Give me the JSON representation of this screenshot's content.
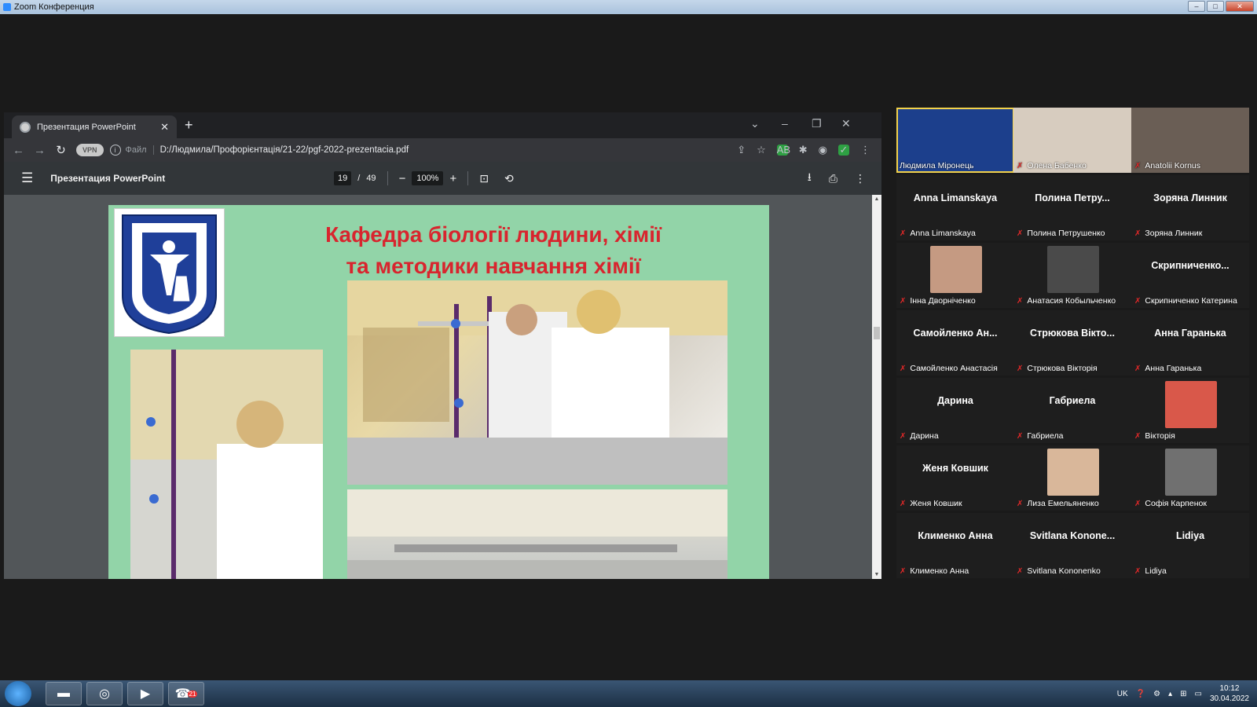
{
  "zoom_window": {
    "title": "Zoom Конференция"
  },
  "browser": {
    "tab_title": "Презентация PowerPoint",
    "vpn_label": "VPN",
    "file_label": "Файл",
    "url": "D:/Людмила/Профорієнтація/21-22/pgf-2022-prezentacia.pdf"
  },
  "pdf_viewer": {
    "title": "Презентация PowerPoint",
    "current_page": "19",
    "page_separator": "/",
    "total_pages": "49",
    "zoom": "100%"
  },
  "slide": {
    "title_line1": "Кафедра біології людини, хімії",
    "title_line2": "та методики навчання хімії"
  },
  "gallery": {
    "participants": [
      {
        "name": "Людмила Міронець",
        "display": "",
        "type": "video",
        "active": true,
        "bg": "#1c3f8c"
      },
      {
        "name": "Олена Бабенко",
        "display": "",
        "type": "video",
        "active": false,
        "bg": "#d7ccbf"
      },
      {
        "name": "Anatolii Kornus",
        "display": "",
        "type": "video",
        "active": false,
        "bg": "#6a5e55"
      },
      {
        "name": "Anna Limanskaya",
        "display": "Anna Limanskaya",
        "type": "name"
      },
      {
        "name": "Полина Петрушенко",
        "display": "Полина Петру...",
        "type": "name"
      },
      {
        "name": "Зоряна Линник",
        "display": "Зоряна Линник",
        "type": "name"
      },
      {
        "name": "Інна Дворніченко",
        "display": "",
        "type": "photo",
        "bg": "#c59a82"
      },
      {
        "name": "Анатасия Кобыльченко",
        "display": "",
        "type": "photo",
        "bg": "#4a4a4a"
      },
      {
        "name": "Скрипниченко Катерина",
        "display": "Скрипниченко...",
        "type": "name"
      },
      {
        "name": "Самойленко Анастасія",
        "display": "Самойленко Ан...",
        "type": "name"
      },
      {
        "name": "Стрюкова Вікторія",
        "display": "Стрюкова Вікто...",
        "type": "name"
      },
      {
        "name": "Анна Гаранька",
        "display": "Анна Гаранька",
        "type": "name"
      },
      {
        "name": "Дарина",
        "display": "Дарина",
        "type": "name"
      },
      {
        "name": "Габриела",
        "display": "Габриела",
        "type": "name"
      },
      {
        "name": "Вікторія",
        "display": "",
        "type": "photo",
        "bg": "#d9584a"
      },
      {
        "name": "Женя Ковшик",
        "display": "Женя Ковшик",
        "type": "name"
      },
      {
        "name": "Лиза Емельяненко",
        "display": "",
        "type": "photo",
        "bg": "#d9b79a"
      },
      {
        "name": "Софія Карпенок",
        "display": "",
        "type": "photo",
        "bg": "#707070"
      },
      {
        "name": "Клименко Анна",
        "display": "Клименко Анна",
        "type": "name"
      },
      {
        "name": "Svitlana Kononenko",
        "display": "Svitlana Konone...",
        "type": "name"
      },
      {
        "name": "Lidiya",
        "display": "Lidiya",
        "type": "name"
      }
    ]
  },
  "taskbar": {
    "language": "UK",
    "time": "10:12",
    "date": "30.04.2022",
    "viber_badge": "21"
  }
}
